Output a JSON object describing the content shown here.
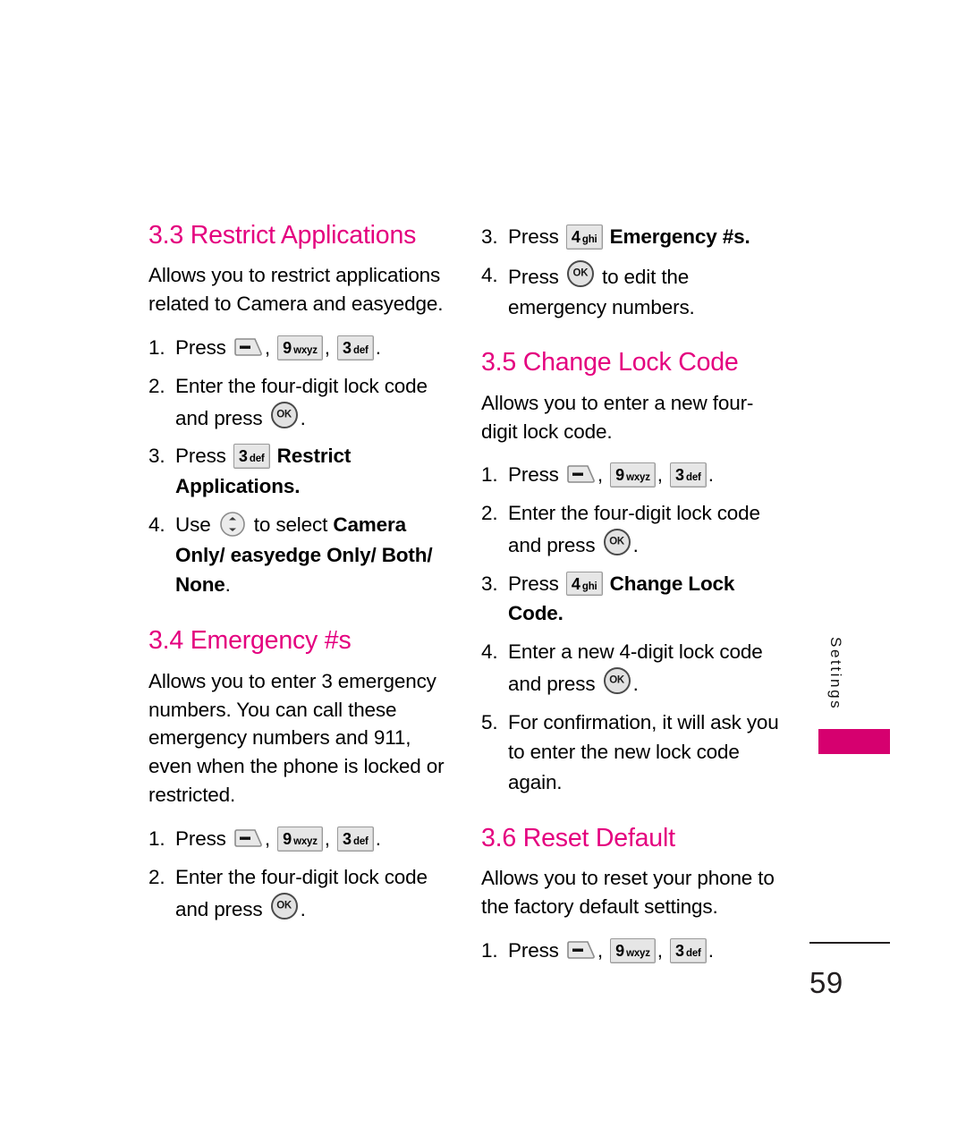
{
  "document": {
    "page_number": "59",
    "side_tab_label": "Settings",
    "accent_color": "#E4007F",
    "tab_color": "#D6006F",
    "text_color": "#000000"
  },
  "icons": {
    "clear_key": "clear-key-icon",
    "ok_key_label": "OK",
    "nav_key": "navigation-pad-icon",
    "key_9": {
      "digit": "9",
      "letters": "wxyz"
    },
    "key_3": {
      "digit": "3",
      "letters": "def"
    },
    "key_4": {
      "digit": "4",
      "letters": "ghi"
    }
  },
  "left_column": {
    "sections": [
      {
        "heading": "3.3 Restrict Applications",
        "intro": "Allows you to restrict applications related to Camera and easyedge.",
        "steps": [
          {
            "num": "1.",
            "text_before": "Press",
            "keys": [
              "clear",
              "9wxyz",
              "3def"
            ],
            "text_after": "."
          },
          {
            "num": "2.",
            "text_before": "Enter the four-digit lock code and press",
            "keys": [
              "ok"
            ],
            "text_after": "."
          },
          {
            "num": "3.",
            "text_before": "Press",
            "keys": [
              "3def"
            ],
            "bold_after": "Restrict Applications",
            "text_after": "."
          },
          {
            "num": "4.",
            "text_before": "Use",
            "keys": [
              "nav"
            ],
            "text_mid": "to select",
            "bold_after": "Camera Only/ easyedge Only/ Both/ None",
            "text_after": "."
          }
        ]
      },
      {
        "heading": "3.4 Emergency #s",
        "intro": "Allows you to enter 3 emergency numbers. You can call these emergency numbers and 911, even when the phone is locked or restricted.",
        "steps": [
          {
            "num": "1.",
            "text_before": "Press",
            "keys": [
              "clear",
              "9wxyz",
              "3def"
            ],
            "text_after": "."
          },
          {
            "num": "2.",
            "text_before": "Enter the four-digit lock code and press",
            "keys": [
              "ok"
            ],
            "text_after": "."
          }
        ]
      }
    ]
  },
  "right_column": {
    "continued_steps": [
      {
        "num": "3.",
        "text_before": "Press",
        "keys": [
          "4ghi"
        ],
        "bold_after": "Emergency #s",
        "text_after": "."
      },
      {
        "num": "4.",
        "text_before": "Press",
        "keys": [
          "ok"
        ],
        "text_mid": "to edit the emergency numbers.",
        "text_after": ""
      }
    ],
    "sections": [
      {
        "heading": "3.5 Change Lock Code",
        "intro": "Allows you to enter a new four-digit lock code.",
        "steps": [
          {
            "num": "1.",
            "text_before": "Press",
            "keys": [
              "clear",
              "9wxyz",
              "3def"
            ],
            "text_after": "."
          },
          {
            "num": "2.",
            "text_before": "Enter the four-digit lock code and press",
            "keys": [
              "ok"
            ],
            "text_after": "."
          },
          {
            "num": "3.",
            "text_before": "Press",
            "keys": [
              "4ghi"
            ],
            "bold_after": "Change Lock Code",
            "text_after": "."
          },
          {
            "num": "4.",
            "text_before": "Enter a new 4-digit lock code and press",
            "keys": [
              "ok"
            ],
            "text_after": "."
          },
          {
            "num": "5.",
            "text_before": "For confirmation, it will ask you to enter the new lock code again.",
            "keys": [],
            "text_after": ""
          }
        ]
      },
      {
        "heading": "3.6 Reset Default",
        "intro": "Allows you to reset your phone to the factory default settings.",
        "steps": [
          {
            "num": "1.",
            "text_before": "Press",
            "keys": [
              "clear",
              "9wxyz",
              "3def"
            ],
            "text_after": "."
          }
        ]
      }
    ]
  }
}
